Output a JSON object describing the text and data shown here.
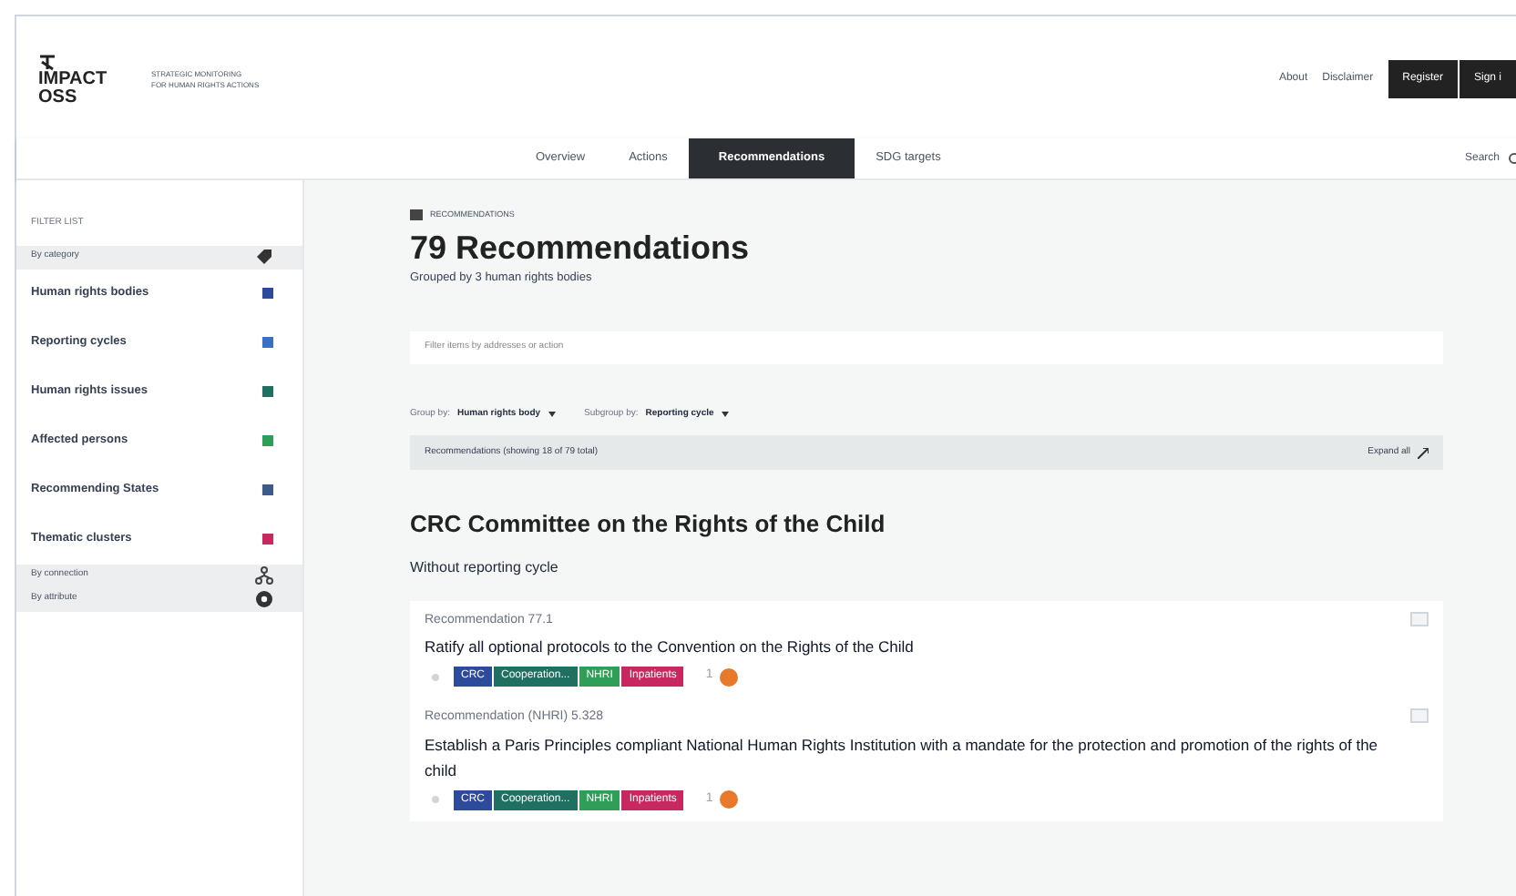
{
  "header": {
    "logo": "IMPACT OSS",
    "tagline": [
      "STRATEGIC MONITORING",
      "FOR HUMAN RIGHTS ACTIONS"
    ],
    "links": [
      "About",
      "Disclaimer"
    ],
    "buttons": [
      "Register",
      "Sign i"
    ],
    "tabs": [
      {
        "label": "Overview",
        "selected": false
      },
      {
        "label": "Actions",
        "selected": false
      },
      {
        "label": "Recommendations",
        "selected": true
      },
      {
        "label": "SDG targets",
        "selected": false
      }
    ],
    "search": "Search"
  },
  "sidebar": {
    "title": "FILTER LIST",
    "sections": [
      {
        "label": "By category",
        "items": [
          {
            "label": "Human rights bodies",
            "color": "#2e4a9a"
          },
          {
            "label": "Reporting cycles",
            "color": "#3a6fc4"
          },
          {
            "label": "Human rights issues",
            "color": "#1f7060"
          },
          {
            "label": "Affected persons",
            "color": "#2f9e58"
          },
          {
            "label": "Recommending States",
            "color": "#3d5a8a"
          },
          {
            "label": "Thematic clusters",
            "color": "#c7285f"
          }
        ]
      },
      {
        "label": "By connection"
      },
      {
        "label": "By attribute"
      }
    ]
  },
  "main": {
    "eyebrow": "RECOMMENDATIONS",
    "title": "79 Recommendations",
    "subtitle": "Grouped by 3 human rights bodies",
    "search_placeholder": "Filter items by addresses or action",
    "group_by": {
      "label": "Group by:",
      "value": "Human rights body"
    },
    "subgroup_by": {
      "label": "Subgroup by:",
      "value": "Reporting cycle"
    },
    "list_header": "Recommendations (showing 18 of 79 total)",
    "expand": "Expand all",
    "group_title": "CRC Committee on the Rights of the Child",
    "subgroup_title": "Without reporting cycle",
    "items": [
      {
        "ref": "Recommendation 77.1",
        "text": "Ratify all optional protocols to the Convention on the Rights of the Child",
        "tags": [
          {
            "label": "CRC",
            "color": "#2e4a9a"
          },
          {
            "label": "Cooperation...",
            "color": "#1f7060"
          },
          {
            "label": "NHRI",
            "color": "#2f9e58"
          },
          {
            "label": "Inpatients",
            "color": "#c7285f"
          }
        ],
        "count": "1",
        "checked": false
      },
      {
        "ref": "Recommendation (NHRI) 5.328",
        "text": "Establish a Paris Principles compliant National Human Rights Institution with a mandate for the protection and promotion of the rights of the child",
        "tags": [
          {
            "label": "CRC",
            "color": "#2e4a9a"
          },
          {
            "label": "Cooperation...",
            "color": "#1f7060"
          },
          {
            "label": "NHRI",
            "color": "#2f9e58"
          },
          {
            "label": "Inpatients",
            "color": "#c7285f"
          }
        ],
        "count": "1",
        "checked": false
      }
    ]
  }
}
